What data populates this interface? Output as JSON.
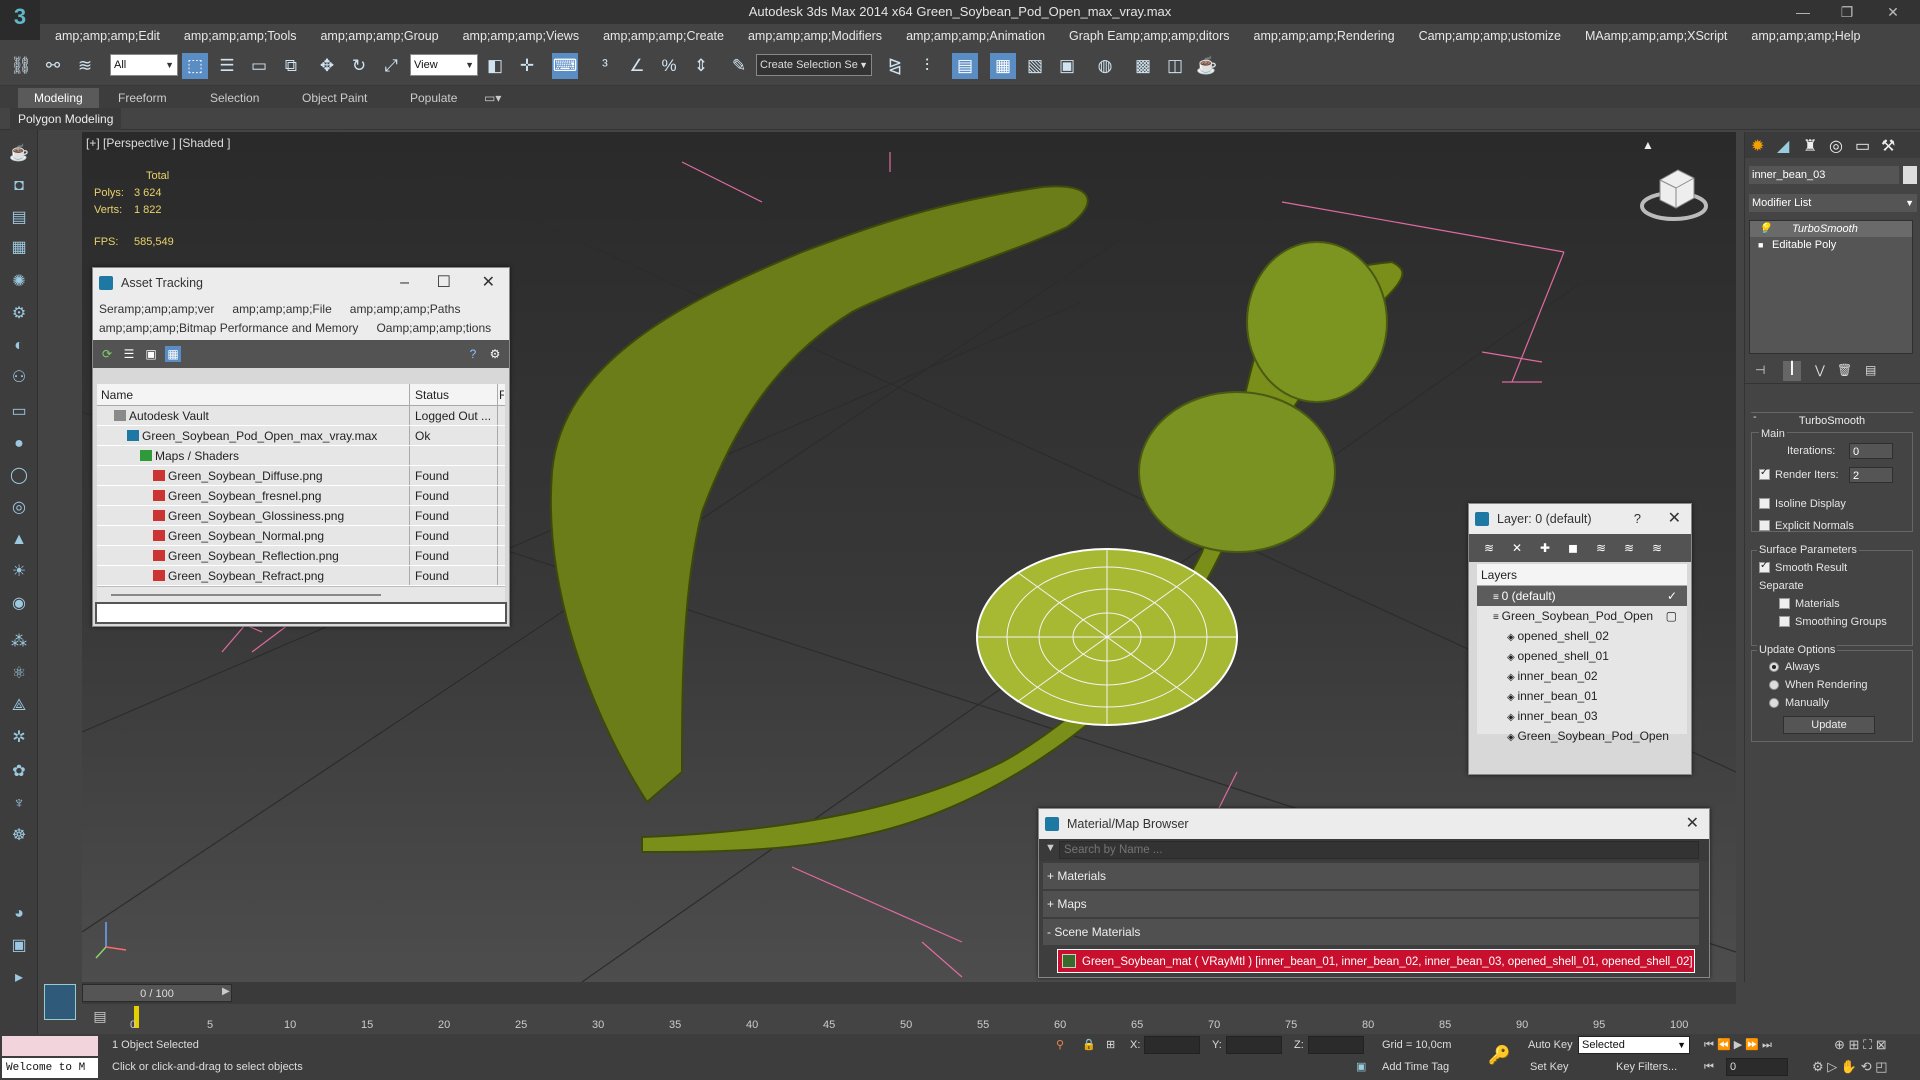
{
  "window": {
    "title": "Autodesk 3ds Max  2014 x64    Green_Soybean_Pod_Open_max_vray.max",
    "logo": "3"
  },
  "menu": [
    "amp;amp;amp;Edit",
    "amp;amp;amp;Tools",
    "amp;amp;amp;Group",
    "amp;amp;amp;Views",
    "amp;amp;amp;Create",
    "amp;amp;amp;Modifiers",
    "amp;amp;amp;Animation",
    "Graph Eamp;amp;amp;ditors",
    "amp;amp;amp;Rendering",
    "Camp;amp;amp;ustomize",
    "MAamp;amp;amp;XScript",
    "amp;amp;amp;Help"
  ],
  "toolbar": {
    "filter": "All",
    "refcoord": "View",
    "selection_set": "Create Selection Se"
  },
  "ribbon": {
    "tabs": [
      "Modeling",
      "Freeform",
      "Selection",
      "Object Paint",
      "Populate"
    ],
    "sub": "Polygon Modeling"
  },
  "viewport": {
    "label": "[+] [Perspective ] [Shaded ]",
    "stats_header": "Total",
    "polys_label": "Polys:",
    "polys": "3 624",
    "verts_label": "Verts:",
    "verts": "1 822",
    "fps_label": "FPS:",
    "fps": "585,549"
  },
  "asset_tracking": {
    "title": "Asset Tracking",
    "menu_row1": [
      "Seramp;amp;amp;ver",
      "amp;amp;amp;File",
      "amp;amp;amp;Paths"
    ],
    "menu_row2": [
      "amp;amp;amp;Bitmap Performance and Memory",
      "Oamp;amp;amp;tions"
    ],
    "columns": [
      "Name",
      "Status",
      "F"
    ],
    "rows": [
      {
        "name": "Autodesk Vault",
        "status": "Logged Out ...",
        "indent": 1,
        "icon": "vault-icon"
      },
      {
        "name": "Green_Soybean_Pod_Open_max_vray.max",
        "status": "Ok",
        "indent": 2,
        "icon": "max-file-icon"
      },
      {
        "name": "Maps / Shaders",
        "status": "",
        "indent": 3,
        "icon": "maps-folder-icon"
      },
      {
        "name": "Green_Soybean_Diffuse.png",
        "status": "Found",
        "indent": 4,
        "icon": "png-file-icon"
      },
      {
        "name": "Green_Soybean_fresnel.png",
        "status": "Found",
        "indent": 4,
        "icon": "png-file-icon"
      },
      {
        "name": "Green_Soybean_Glossiness.png",
        "status": "Found",
        "indent": 4,
        "icon": "png-file-icon"
      },
      {
        "name": "Green_Soybean_Normal.png",
        "status": "Found",
        "indent": 4,
        "icon": "png-file-icon"
      },
      {
        "name": "Green_Soybean_Reflection.png",
        "status": "Found",
        "indent": 4,
        "icon": "png-file-icon"
      },
      {
        "name": "Green_Soybean_Refract.png",
        "status": "Found",
        "indent": 4,
        "icon": "png-file-icon"
      }
    ]
  },
  "layers": {
    "title": "Layer: 0 (default)",
    "help": "?",
    "header": "Layers",
    "rows": [
      {
        "name": "0 (default)",
        "indent": 1,
        "selected": true,
        "mark": "✓"
      },
      {
        "name": "Green_Soybean_Pod_Open",
        "indent": 1,
        "selected": false,
        "mark": "▢"
      },
      {
        "name": "opened_shell_02",
        "indent": 2,
        "selected": false,
        "mark": ""
      },
      {
        "name": "opened_shell_01",
        "indent": 2,
        "selected": false,
        "mark": ""
      },
      {
        "name": "inner_bean_02",
        "indent": 2,
        "selected": false,
        "mark": ""
      },
      {
        "name": "inner_bean_01",
        "indent": 2,
        "selected": false,
        "mark": ""
      },
      {
        "name": "inner_bean_03",
        "indent": 2,
        "selected": false,
        "mark": ""
      },
      {
        "name": "Green_Soybean_Pod_Open",
        "indent": 2,
        "selected": false,
        "mark": ""
      }
    ]
  },
  "material_browser": {
    "title": "Material/Map Browser",
    "search_placeholder": "Search by Name ...",
    "sections": [
      "+ Materials",
      "+ Maps",
      "- Scene Materials"
    ],
    "scene_material": "Green_Soybean_mat  ( VRayMtl ) [inner_bean_01, inner_bean_02, inner_bean_03, opened_shell_01, opened_shell_02]"
  },
  "command_panel": {
    "object_name": "inner_bean_03",
    "modifier_list": "Modifier List",
    "stack": [
      "TurboSmooth",
      "Editable Poly"
    ],
    "rollout": "TurboSmooth",
    "main": "Main",
    "iterations_label": "Iterations:",
    "iterations": "0",
    "render_iters_label": "Render Iters:",
    "render_iters": "2",
    "isoline": "Isoline Display",
    "explicit_normals": "Explicit Normals",
    "surface_params": "Surface Parameters",
    "smooth_result": "Smooth Result",
    "separate": "Separate",
    "materials": "Materials",
    "smoothing_groups": "Smoothing Groups",
    "update_options": "Update Options",
    "always": "Always",
    "when_rendering": "When Rendering",
    "manually": "Manually",
    "update_button": "Update"
  },
  "timeline": {
    "slider": "0 / 100",
    "ticks": [
      "0",
      "5",
      "10",
      "15",
      "20",
      "25",
      "30",
      "35",
      "40",
      "45",
      "50",
      "55",
      "60",
      "65",
      "70",
      "75",
      "80",
      "85",
      "90",
      "95",
      "100"
    ]
  },
  "status": {
    "selected": "1 Object Selected",
    "prompt": "Click or click-and-drag to select objects",
    "welcome": "Welcome to M",
    "x_label": "X:",
    "y_label": "Y:",
    "z_label": "Z:",
    "grid": "Grid = 10,0cm",
    "auto_key": "Auto Key",
    "set_key": "Set Key",
    "key_mode": "Selected",
    "key_filters": "Key Filters...",
    "add_time_tag": "Add Time Tag",
    "frame": "0"
  }
}
